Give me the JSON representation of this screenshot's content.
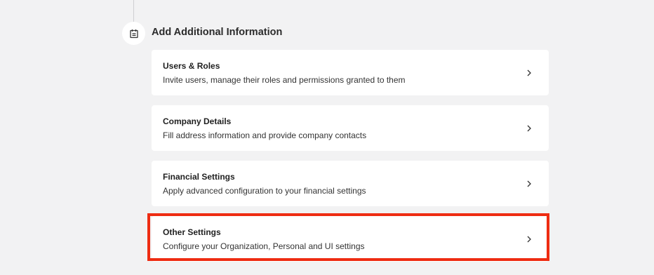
{
  "section": {
    "title": "Add Additional Information",
    "icon": "calendar-icon"
  },
  "cards": [
    {
      "title": "Users & Roles",
      "description": "Invite users, manage their roles and permissions granted to them"
    },
    {
      "title": "Company Details",
      "description": "Fill address information and provide company contacts"
    },
    {
      "title": "Financial Settings",
      "description": "Apply advanced configuration to your financial settings"
    },
    {
      "title": "Other Settings",
      "description": "Configure your Organization, Personal and UI settings"
    }
  ],
  "highlight": {
    "color": "#ee2c12",
    "target": "Other Settings"
  },
  "colors": {
    "background": "#f2f2f3",
    "card": "#ffffff"
  }
}
